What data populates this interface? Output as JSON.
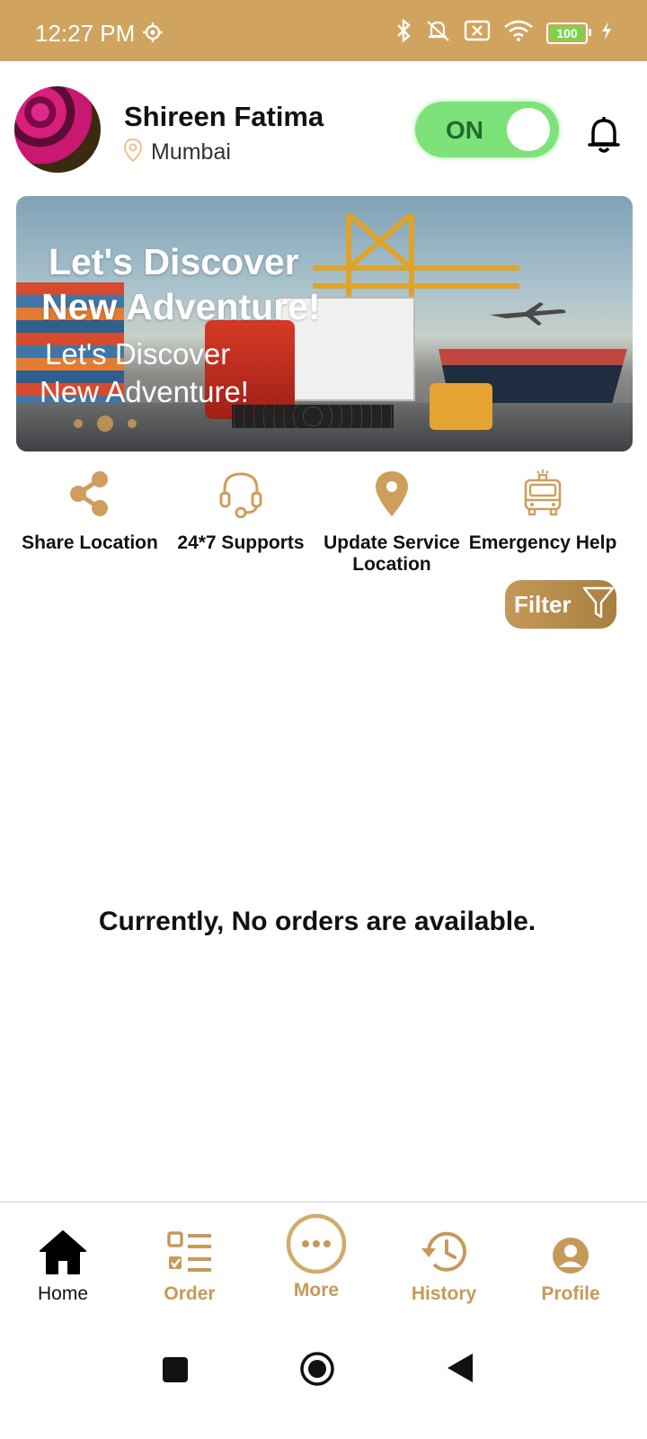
{
  "status_bar": {
    "time": "12:27 PM",
    "battery": "100"
  },
  "header": {
    "user_name": "Shireen Fatima",
    "location": "Mumbai",
    "toggle_label": "ON"
  },
  "banner": {
    "title_line1": "Let's Discover",
    "title_line2": "New Adventure!",
    "subtitle_line1": "Let's Discover",
    "subtitle_line2": "New Adventure!"
  },
  "quick_actions": [
    {
      "label": "Share Location",
      "icon": "share-icon"
    },
    {
      "label": "24*7 Supports",
      "icon": "headset-icon"
    },
    {
      "label": "Update Service Location",
      "icon": "location-pin-icon"
    },
    {
      "label": "Emergency Help",
      "icon": "fire-truck-icon"
    }
  ],
  "filter": {
    "label": "Filter"
  },
  "main": {
    "empty_message": "Currently, No orders are available."
  },
  "bottom_nav": {
    "items": [
      {
        "label": "Home"
      },
      {
        "label": "Order"
      },
      {
        "label": "More"
      },
      {
        "label": "History"
      },
      {
        "label": "Profile"
      }
    ]
  },
  "colors": {
    "status_bar": "#d0a45e",
    "accent_gold": "#c59a58",
    "toggle_on": "#7ee27a"
  }
}
